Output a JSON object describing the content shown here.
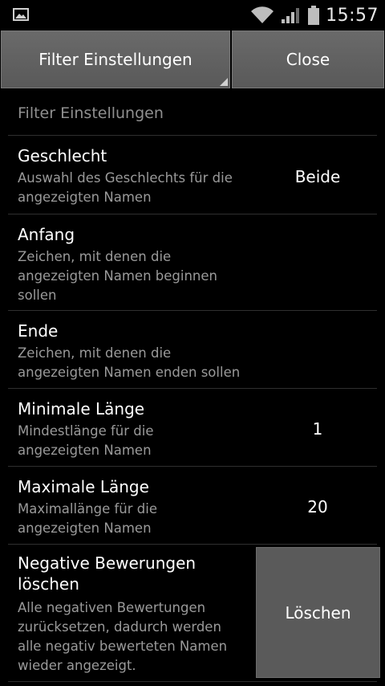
{
  "status": {
    "time": "15:57"
  },
  "toolbar": {
    "filter_label": "Filter Einstellungen",
    "close_label": "Close"
  },
  "section_title": "Filter Einstellungen",
  "rows": [
    {
      "title": "Geschlecht",
      "desc": "Auswahl des Geschlechts für die angezeigten Namen",
      "value": "Beide"
    },
    {
      "title": "Anfang",
      "desc": "Zeichen, mit denen die angezeigten Namen beginnen sollen",
      "value": ""
    },
    {
      "title": "Ende",
      "desc": "Zeichen, mit denen die angezeigten Namen enden sollen",
      "value": ""
    },
    {
      "title": "Minimale Länge",
      "desc": "Mindestlänge für die angezeigten Namen",
      "value": "1"
    },
    {
      "title": "Maximale Länge",
      "desc": "Maximallänge für die angezeigten Namen",
      "value": "20"
    },
    {
      "title": "Negative Bewerungen löschen",
      "desc": "Alle negativen Bewertungen zurücksetzen, dadurch werden alle negativ bewerteten Namen wieder angezeigt.",
      "button": "Löschen"
    }
  ]
}
